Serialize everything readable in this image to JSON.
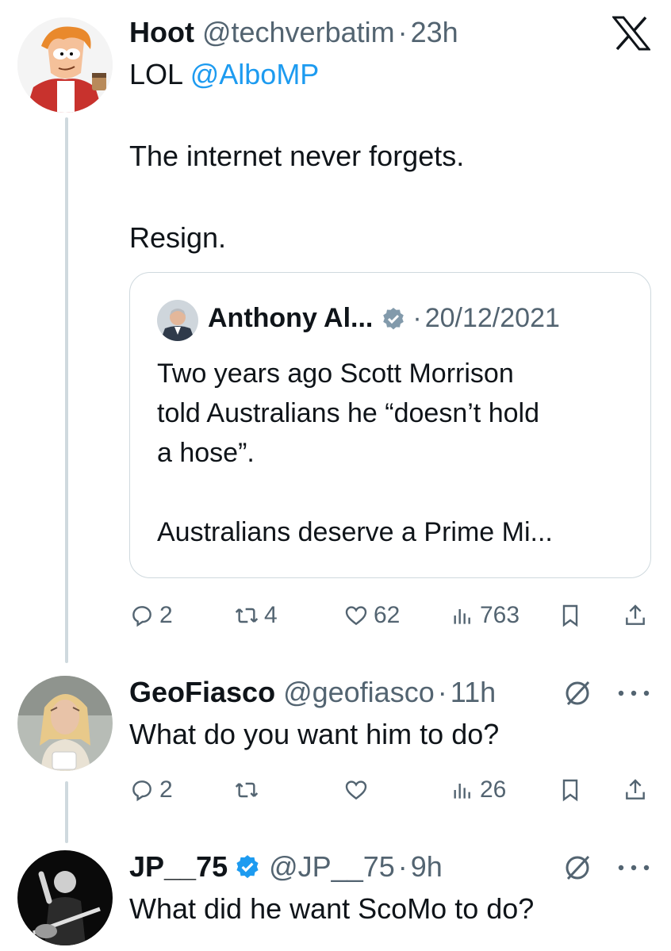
{
  "brand": {
    "accent": "#1d9bf0",
    "text": "#0f1419",
    "muted": "#536471",
    "border": "#cfd9de"
  },
  "close_icon": "x-logo-icon",
  "tweets": [
    {
      "name": "Hoot",
      "handle": "@techverbatim",
      "time": "23h",
      "line1_prefix": "LOL ",
      "mention": "@AlboMP",
      "line2": "The internet never forgets.",
      "line3": "Resign.",
      "quote": {
        "name": "Anthony Al...",
        "date": "20/12/2021",
        "lines": [
          "Two years ago Scott Morrison",
          "told Australians he “doesn’t hold",
          "a hose”.",
          "Australians deserve a Prime Mi..."
        ]
      },
      "actions": {
        "replies": "2",
        "retweets": "4",
        "likes": "62",
        "views": "763"
      }
    },
    {
      "name": "GeoFiasco",
      "handle": "@geofiasco",
      "time": "11h",
      "text": "What do you want him to do?",
      "actions": {
        "replies": "2",
        "retweets": "",
        "likes": "",
        "views": "26"
      }
    },
    {
      "name": "JP__75",
      "handle": "@JP__75",
      "time": "9h",
      "text": "What did he want ScoMo to do?"
    }
  ]
}
